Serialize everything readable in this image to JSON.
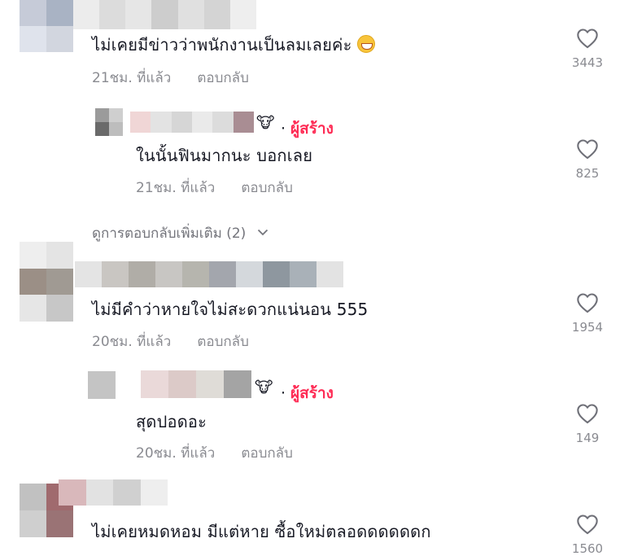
{
  "comments": [
    {
      "text": "ไม่เคยมีข่าวว่าพนักงานเป็นลมเลยค่ะ",
      "time": "21ชม. ที่แล้ว",
      "reply_label": "ตอบกลับ",
      "likes": "3443",
      "emoji_icon": "grinning-face-icon"
    },
    {
      "creator_label": "ผู้สร้าง",
      "text": "ในนั้นฟินมากนะ บอกเลย",
      "time": "21ชม. ที่แล้ว",
      "reply_label": "ตอบกลับ",
      "likes": "825"
    },
    {
      "text": "ไม่มีคำว่าหายใจไม่สะดวกแน่นอน 555",
      "time": "20ชม. ที่แล้ว",
      "reply_label": "ตอบกลับ",
      "likes": "1954"
    },
    {
      "creator_label": "ผู้สร้าง",
      "text": "สุดปอดอะ",
      "time": "20ชม. ที่แล้ว",
      "reply_label": "ตอบกลับ",
      "likes": "149"
    },
    {
      "text": "ไม่เคยหมดหอม มีแต่หาย ซื้อใหม่ตลอดดดดดดก",
      "likes": "1560"
    }
  ],
  "view_more": {
    "label": "ดูการตอบกลับเพิ่มเติม (2)"
  },
  "colors": {
    "accent": "#fe2c55",
    "secondary_text": "#8a8b91"
  }
}
